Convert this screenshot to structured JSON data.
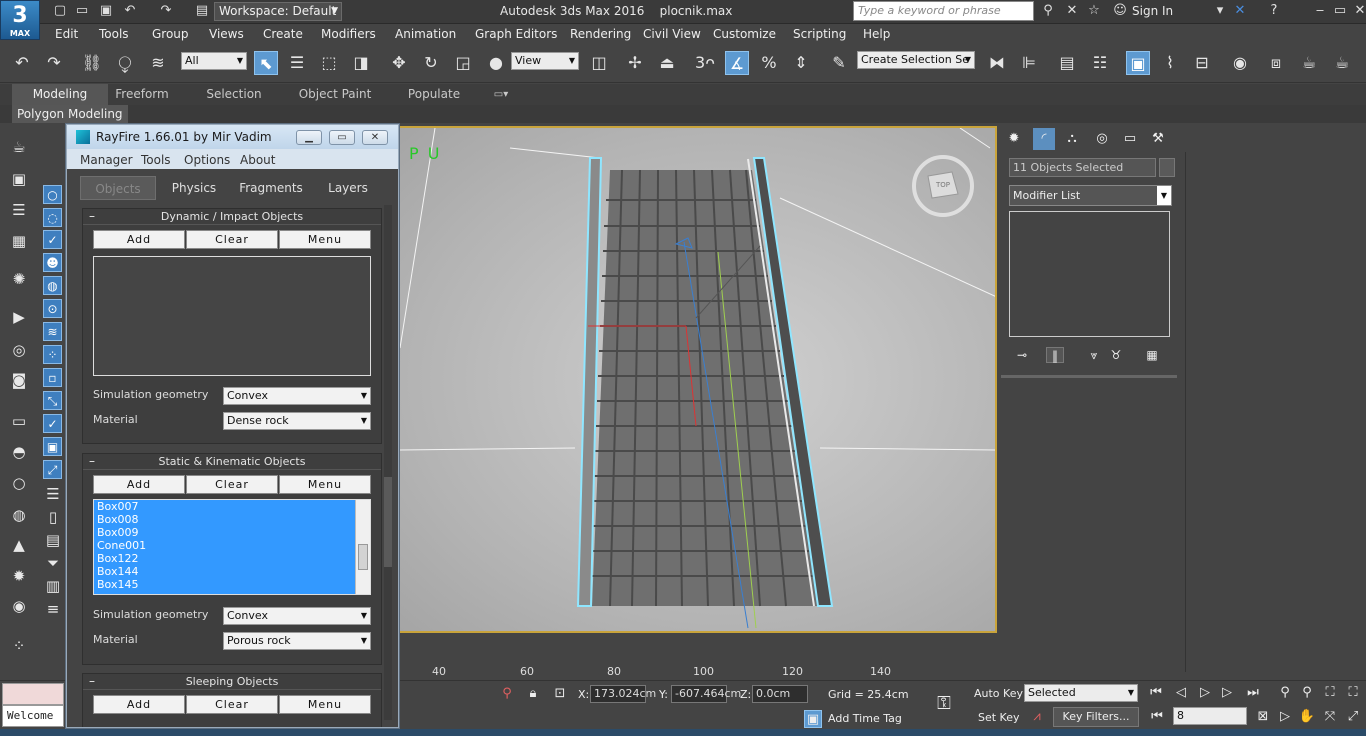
{
  "titlebar": {
    "workspace": "Workspace: Default",
    "app_name": "Autodesk 3ds Max 2016",
    "file_name": "plocnik.max",
    "search_placeholder": "Type a keyword or phrase",
    "sign_in": "Sign In",
    "logo_text": "MAX"
  },
  "menubar": {
    "items": [
      "Edit",
      "Tools",
      "Group",
      "Views",
      "Create",
      "Modifiers",
      "Animation",
      "Graph Editors",
      "Rendering",
      "Civil View",
      "Customize",
      "Scripting",
      "Help"
    ]
  },
  "toolbar": {
    "selection_filter": "All",
    "reference_coord": "View",
    "named_selection": "Create Selection Se",
    "snap_value": "3"
  },
  "ribbon": {
    "tabs": [
      "Modeling",
      "Freeform",
      "Selection",
      "Object Paint",
      "Populate"
    ],
    "sub_label": "Polygon Modeling"
  },
  "viewport": {
    "label_fragment": "P U",
    "nav_cube_label": "TOP"
  },
  "ruler": {
    "labels": [
      "40",
      "60",
      "80",
      "100",
      "120",
      "140"
    ]
  },
  "status": {
    "welcome": "Welcome",
    "x_label": "X:",
    "x_value": "173.024cm",
    "y_label": "Y:",
    "y_value": "-607.464cm",
    "z_label": "Z:",
    "z_value": "0.0cm",
    "grid": "Grid = 25.4cm",
    "add_time_tag": "Add Time Tag",
    "auto_key": "Auto Key",
    "set_key": "Set Key",
    "selected": "Selected",
    "key_filters": "Key Filters...",
    "frame": "8"
  },
  "command_panel": {
    "objects_selected": "11 Objects Selected",
    "modifier_list": "Modifier List"
  },
  "rayfire": {
    "title": "RayFire 1.66.01  by Mir Vadim",
    "menus": [
      "Manager",
      "Tools",
      "Options",
      "About"
    ],
    "tabs": [
      "Objects",
      "Physics",
      "Fragments",
      "Layers"
    ],
    "rollouts": {
      "dynamic": {
        "title": "Dynamic / Impact Objects",
        "add": "Add",
        "clear": "Clear",
        "menu": "Menu",
        "sim_label": "Simulation geometry",
        "sim_value": "Convex",
        "mat_label": "Material",
        "mat_value": "Dense rock"
      },
      "static": {
        "title": "Static & Kinematic Objects",
        "add": "Add",
        "clear": "Clear",
        "menu": "Menu",
        "items": [
          "Box007",
          "Box008",
          "Box009",
          "Cone001",
          "Box122",
          "Box144",
          "Box145"
        ],
        "sim_label": "Simulation geometry",
        "sim_value": "Convex",
        "mat_label": "Material",
        "mat_value": "Porous rock"
      },
      "sleeping": {
        "title": "Sleeping Objects",
        "add": "Add",
        "clear": "Clear",
        "menu": "Menu"
      }
    }
  },
  "colors": {
    "accent": "#5d9ad1",
    "viewport_border": "#c9a43b",
    "selection": "#3399ff",
    "object_outline": "#8fe6ff"
  }
}
